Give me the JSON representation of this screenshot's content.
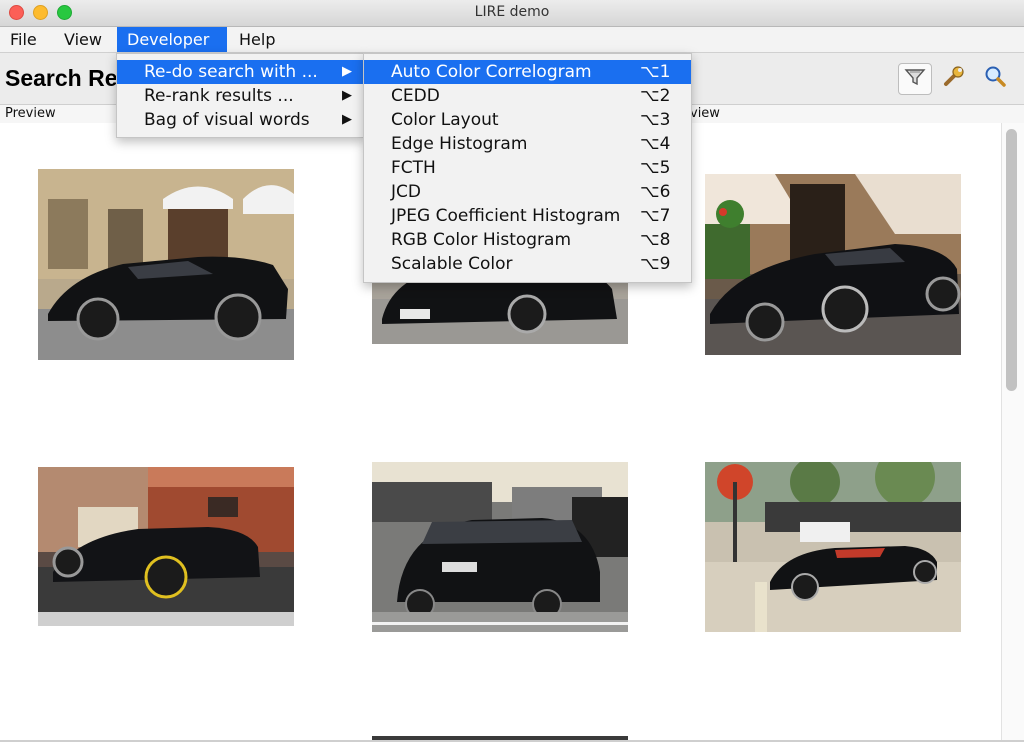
{
  "window": {
    "title": "LIRE demo"
  },
  "menubar": {
    "items": [
      {
        "label": "File",
        "active": false
      },
      {
        "label": "View",
        "active": false
      },
      {
        "label": "Developer",
        "active": true
      },
      {
        "label": "Help",
        "active": false
      }
    ]
  },
  "toolbar": {
    "title": "Search Re",
    "icons": [
      "filter-icon",
      "wrench-icon",
      "search-icon"
    ]
  },
  "table": {
    "col_header_left": "Preview",
    "col_header_right": "eview"
  },
  "developer_menu": {
    "items": [
      {
        "label": "Re-do search with ...",
        "has_submenu": true,
        "highlighted": true
      },
      {
        "label": "Re-rank results ...",
        "has_submenu": true,
        "highlighted": false
      },
      {
        "label": "Bag of visual words",
        "has_submenu": true,
        "highlighted": false
      }
    ],
    "arrow": "▶"
  },
  "redo_submenu": {
    "items": [
      {
        "label": "Auto Color Correlogram",
        "shortcut": "⌥1",
        "highlighted": true
      },
      {
        "label": "CEDD",
        "shortcut": "⌥2",
        "highlighted": false
      },
      {
        "label": "Color Layout",
        "shortcut": "⌥3",
        "highlighted": false
      },
      {
        "label": "Edge Histogram",
        "shortcut": "⌥4",
        "highlighted": false
      },
      {
        "label": "FCTH",
        "shortcut": "⌥5",
        "highlighted": false
      },
      {
        "label": "JCD",
        "shortcut": "⌥6",
        "highlighted": false
      },
      {
        "label": "JPEG Coefficient Histogram",
        "shortcut": "⌥7",
        "highlighted": false
      },
      {
        "label": "RGB Color Histogram",
        "shortcut": "⌥8",
        "highlighted": false
      },
      {
        "label": "Scalable Color",
        "shortcut": "⌥9",
        "highlighted": false
      }
    ]
  },
  "results": [
    {
      "kind": "car-photo",
      "scene": "street-building"
    },
    {
      "kind": "car-photo",
      "scene": "street"
    },
    {
      "kind": "car-photo",
      "scene": "awnings"
    },
    {
      "kind": "car-photo",
      "scene": "city-red-building"
    },
    {
      "kind": "car-photo",
      "scene": "traffic"
    },
    {
      "kind": "car-photo",
      "scene": "convertible-street"
    }
  ],
  "colors": {
    "accent": "#1a6ff0",
    "car": "#0f0f12"
  }
}
